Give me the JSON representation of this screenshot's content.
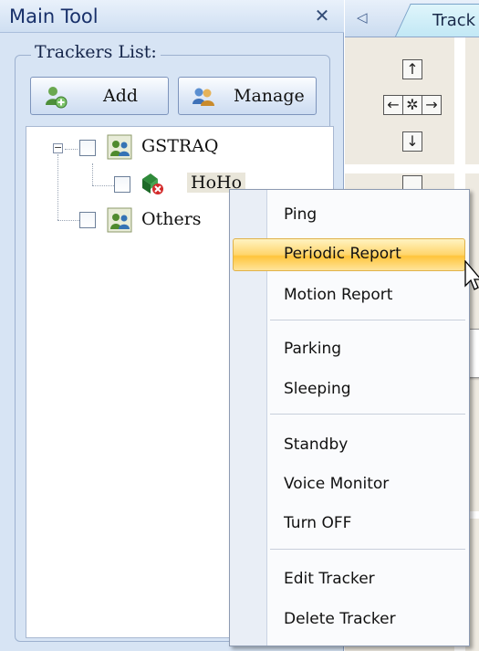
{
  "panel": {
    "title": "Main Tool",
    "close_glyph": "✕",
    "group_label": "Trackers List:",
    "buttons": {
      "add_label": "Add",
      "manage_label": "Manage"
    }
  },
  "tree": {
    "nodes": [
      {
        "label": "GSTRAQ",
        "expander": "−"
      },
      {
        "label": "HoHo"
      },
      {
        "label": "Others"
      }
    ]
  },
  "map": {
    "tab_label": "Track",
    "tab_left_arrow": "◁",
    "pad": {
      "up": "↑",
      "left": "←",
      "center": "✲",
      "right": "→",
      "down": "↓"
    }
  },
  "context_menu": {
    "items": [
      {
        "label": "Ping",
        "highlighted": false
      },
      {
        "label": "Periodic Report",
        "highlighted": true
      },
      {
        "label": "Motion Report",
        "highlighted": false
      },
      {
        "label": "Parking",
        "highlighted": false
      },
      {
        "label": "Sleeping",
        "highlighted": false
      },
      {
        "label": "Standby",
        "highlighted": false
      },
      {
        "label": "Voice Monitor",
        "highlighted": false
      },
      {
        "label": "Turn OFF",
        "highlighted": false
      },
      {
        "label": "Edit Tracker",
        "highlighted": false
      },
      {
        "label": "Delete Tracker",
        "highlighted": false
      }
    ]
  },
  "colors": {
    "panel_bg": "#d7e4f4",
    "highlight": "#ffd56b",
    "title_text": "#18306a"
  }
}
